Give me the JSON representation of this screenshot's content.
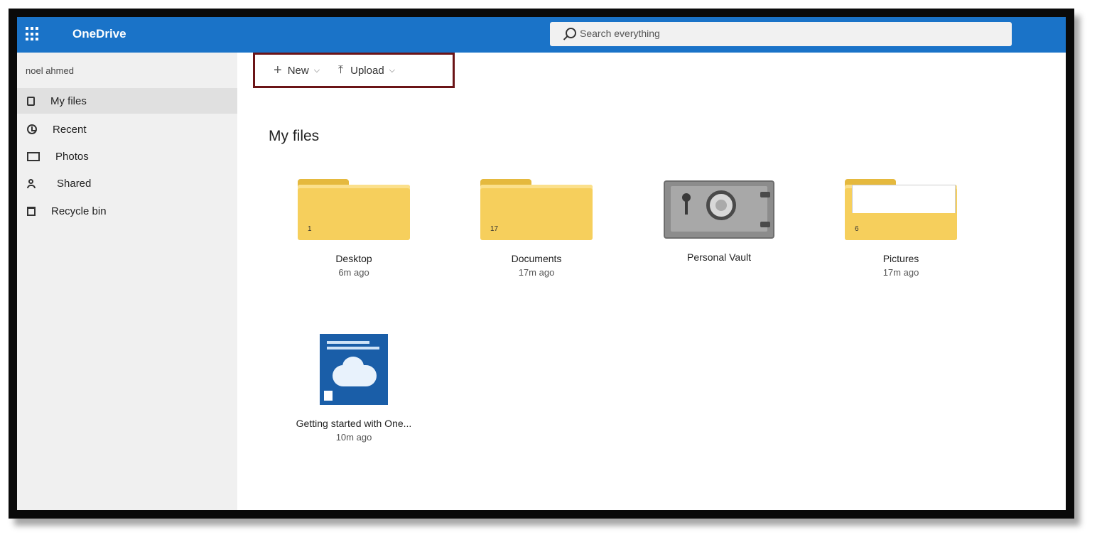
{
  "app": {
    "title": "OneDrive"
  },
  "search": {
    "placeholder": "Search everything"
  },
  "sidebar": {
    "user": "noel ahmed",
    "items": [
      {
        "label": "My files",
        "icon": "file-icon",
        "active": true
      },
      {
        "label": "Recent",
        "icon": "clock-icon",
        "active": false
      },
      {
        "label": "Photos",
        "icon": "photo-icon",
        "active": false
      },
      {
        "label": "Shared",
        "icon": "share-icon",
        "active": false
      },
      {
        "label": "Recycle bin",
        "icon": "recycle-bin-icon",
        "active": false
      }
    ]
  },
  "commands": {
    "new_label": "New",
    "upload_label": "Upload"
  },
  "main": {
    "title": "My files",
    "tiles": [
      {
        "name": "Desktop",
        "meta": "6m ago",
        "count": "1",
        "kind": "folder"
      },
      {
        "name": "Documents",
        "meta": "17m ago",
        "count": "17",
        "kind": "folder"
      },
      {
        "name": "Personal Vault",
        "meta": "",
        "kind": "vault"
      },
      {
        "name": "Pictures",
        "meta": "17m ago",
        "count": "6",
        "kind": "folder-preview"
      },
      {
        "name": "Getting started with One...",
        "meta": "10m ago",
        "kind": "document"
      }
    ]
  },
  "colors": {
    "topbar": "#1a73c8",
    "sidebar": "#f0f0f0",
    "folder": "#f6cf5c",
    "highlight_border": "#6b1417"
  }
}
